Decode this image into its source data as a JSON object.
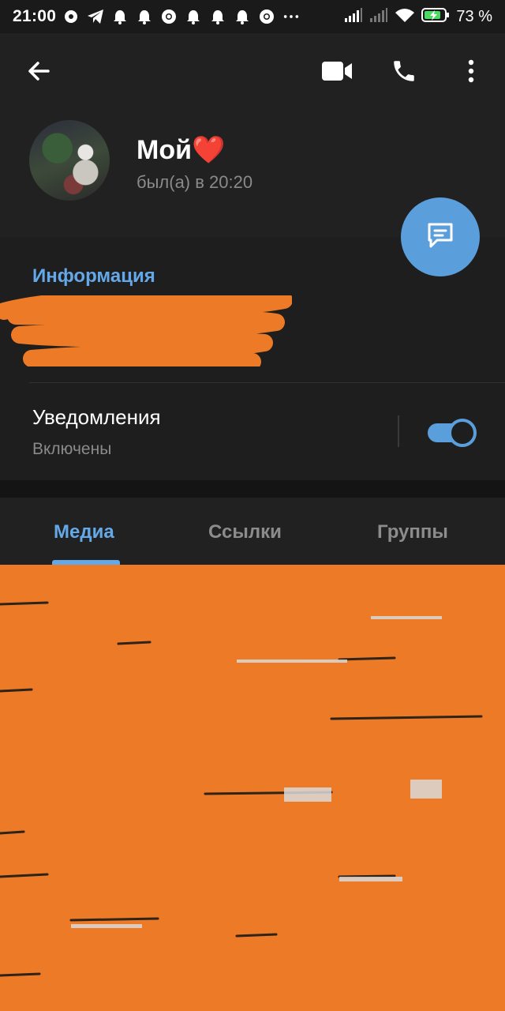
{
  "status_bar": {
    "time": "21:00",
    "battery": "73 %",
    "icons": [
      "alarm-icon",
      "telegram-icon",
      "alarm-icon",
      "alarm-icon",
      "chrome-icon",
      "alarm-icon",
      "alarm-icon",
      "alarm-icon",
      "chrome-icon",
      "more-dots-icon",
      "signal-icon",
      "signal-icon",
      "wifi-icon",
      "battery-icon"
    ]
  },
  "toolbar": {
    "back_icon": "arrow-left-icon",
    "video_icon": "video-call-icon",
    "call_icon": "phone-icon",
    "menu_icon": "more-vert-icon"
  },
  "profile": {
    "name": "Мой❤️",
    "last_seen": "был(а) в 20:20"
  },
  "info": {
    "section_title": "Информация",
    "notifications_label": "Уведомления",
    "notifications_value": "Включены",
    "notifications_enabled": true
  },
  "tabs": [
    {
      "label": "Медиа",
      "active": true
    },
    {
      "label": "Ссылки",
      "active": false
    },
    {
      "label": "Группы",
      "active": false
    }
  ],
  "colors": {
    "accent": "#64a8e8",
    "fab": "#5a9fdb",
    "redaction": "#ed7a26",
    "background": "#1f1f1f"
  }
}
